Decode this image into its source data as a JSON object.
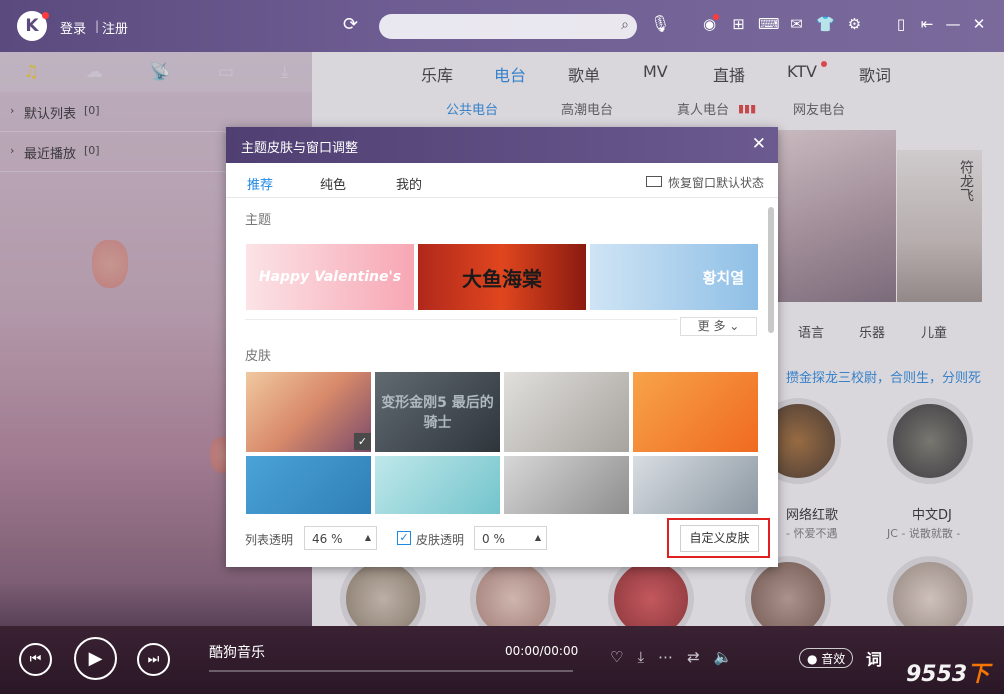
{
  "titlebar": {
    "logo": "K",
    "login": "登录",
    "separator": "|",
    "register": "注册"
  },
  "left": {
    "lists": [
      {
        "name": "默认列表",
        "count": "[0]"
      },
      {
        "name": "最近播放",
        "count": "[0]"
      }
    ]
  },
  "nav": {
    "tabs": [
      "乐库",
      "电台",
      "歌单",
      "MV",
      "直播",
      "KTV",
      "歌词"
    ],
    "active": "电台",
    "subtabs": [
      "公共电台",
      "高潮电台",
      "真人电台",
      "网友电台"
    ]
  },
  "content": {
    "banner_text": "符龙飞",
    "categories": [
      "语言",
      "乐器",
      "儿童"
    ],
    "promo": "攒金探龙三校尉，合则生，分则死",
    "stations": [
      {
        "title": "网络红歌",
        "sub": "- 怀爱不遇"
      },
      {
        "title": "中文DJ",
        "sub": "JC - 说散就散 -"
      }
    ]
  },
  "modal": {
    "title": "主题皮肤与窗口调整",
    "close": "✕",
    "tabs": [
      "推荐",
      "纯色",
      "我的"
    ],
    "restore": "恢复窗口默认状态",
    "section_theme": "主题",
    "section_skin": "皮肤",
    "more": "更 多",
    "themes": [
      "Happy Valentine's",
      "大鱼海棠",
      "황치열"
    ],
    "skins": [
      "",
      "变形金刚5 最后的骑士",
      "",
      "",
      "",
      "",
      "",
      ""
    ],
    "list_alpha_label": "列表透明",
    "list_alpha_value": "46 %",
    "skin_alpha_label": "皮肤透明",
    "skin_alpha_value": "0 %",
    "custom_skin": "自定义皮肤"
  },
  "player": {
    "song": "酷狗音乐",
    "time": "00:00/00:00",
    "effect": "音效",
    "lyric": "词",
    "watermark": "9553",
    "watermark_suffix": "下载"
  }
}
